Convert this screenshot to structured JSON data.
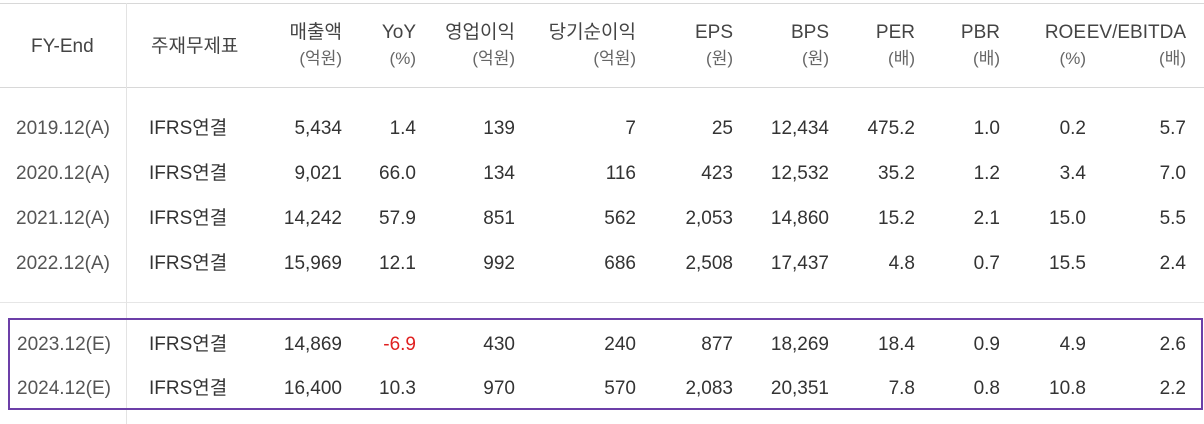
{
  "headers": [
    {
      "l1": "FY-End",
      "l2": ""
    },
    {
      "l1": "주재무제표",
      "l2": ""
    },
    {
      "l1": "매출액",
      "l2": "(억원)"
    },
    {
      "l1": "YoY",
      "l2": "(%)"
    },
    {
      "l1": "영업이익",
      "l2": "(억원)"
    },
    {
      "l1": "당기순이익",
      "l2": "(억원)"
    },
    {
      "l1": "EPS",
      "l2": "(원)"
    },
    {
      "l1": "BPS",
      "l2": "(원)"
    },
    {
      "l1": "PER",
      "l2": "(배)"
    },
    {
      "l1": "PBR",
      "l2": "(배)"
    },
    {
      "l1": "ROE",
      "l2": "(%)"
    },
    {
      "l1": "EV/EBITDA",
      "l2": "(배)"
    }
  ],
  "rows": [
    {
      "fy": "2019.12(A)",
      "type": "IFRS연결",
      "sales": "5,434",
      "yoy": "1.4",
      "op": "139",
      "net": "7",
      "eps": "25",
      "bps": "12,434",
      "per": "475.2",
      "pbr": "1.0",
      "roe": "0.2",
      "ev": "5.7"
    },
    {
      "fy": "2020.12(A)",
      "type": "IFRS연결",
      "sales": "9,021",
      "yoy": "66.0",
      "op": "134",
      "net": "116",
      "eps": "423",
      "bps": "12,532",
      "per": "35.2",
      "pbr": "1.2",
      "roe": "3.4",
      "ev": "7.0"
    },
    {
      "fy": "2021.12(A)",
      "type": "IFRS연결",
      "sales": "14,242",
      "yoy": "57.9",
      "op": "851",
      "net": "562",
      "eps": "2,053",
      "bps": "14,860",
      "per": "15.2",
      "pbr": "2.1",
      "roe": "15.0",
      "ev": "5.5"
    },
    {
      "fy": "2022.12(A)",
      "type": "IFRS연결",
      "sales": "15,969",
      "yoy": "12.1",
      "op": "992",
      "net": "686",
      "eps": "2,508",
      "bps": "17,437",
      "per": "4.8",
      "pbr": "0.7",
      "roe": "15.5",
      "ev": "2.4"
    },
    {
      "fy": "2023.12(E)",
      "type": "IFRS연결",
      "sales": "14,869",
      "yoy": "-6.9",
      "op": "430",
      "net": "240",
      "eps": "877",
      "bps": "18,269",
      "per": "18.4",
      "pbr": "0.9",
      "roe": "4.9",
      "ev": "2.6"
    },
    {
      "fy": "2024.12(E)",
      "type": "IFRS연결",
      "sales": "16,400",
      "yoy": "10.3",
      "op": "970",
      "net": "570",
      "eps": "2,083",
      "bps": "20,351",
      "per": "7.8",
      "pbr": "0.8",
      "roe": "10.8",
      "ev": "2.2"
    }
  ],
  "colors": {
    "negative": "#e02020",
    "highlight_border": "#6c3fa8"
  }
}
